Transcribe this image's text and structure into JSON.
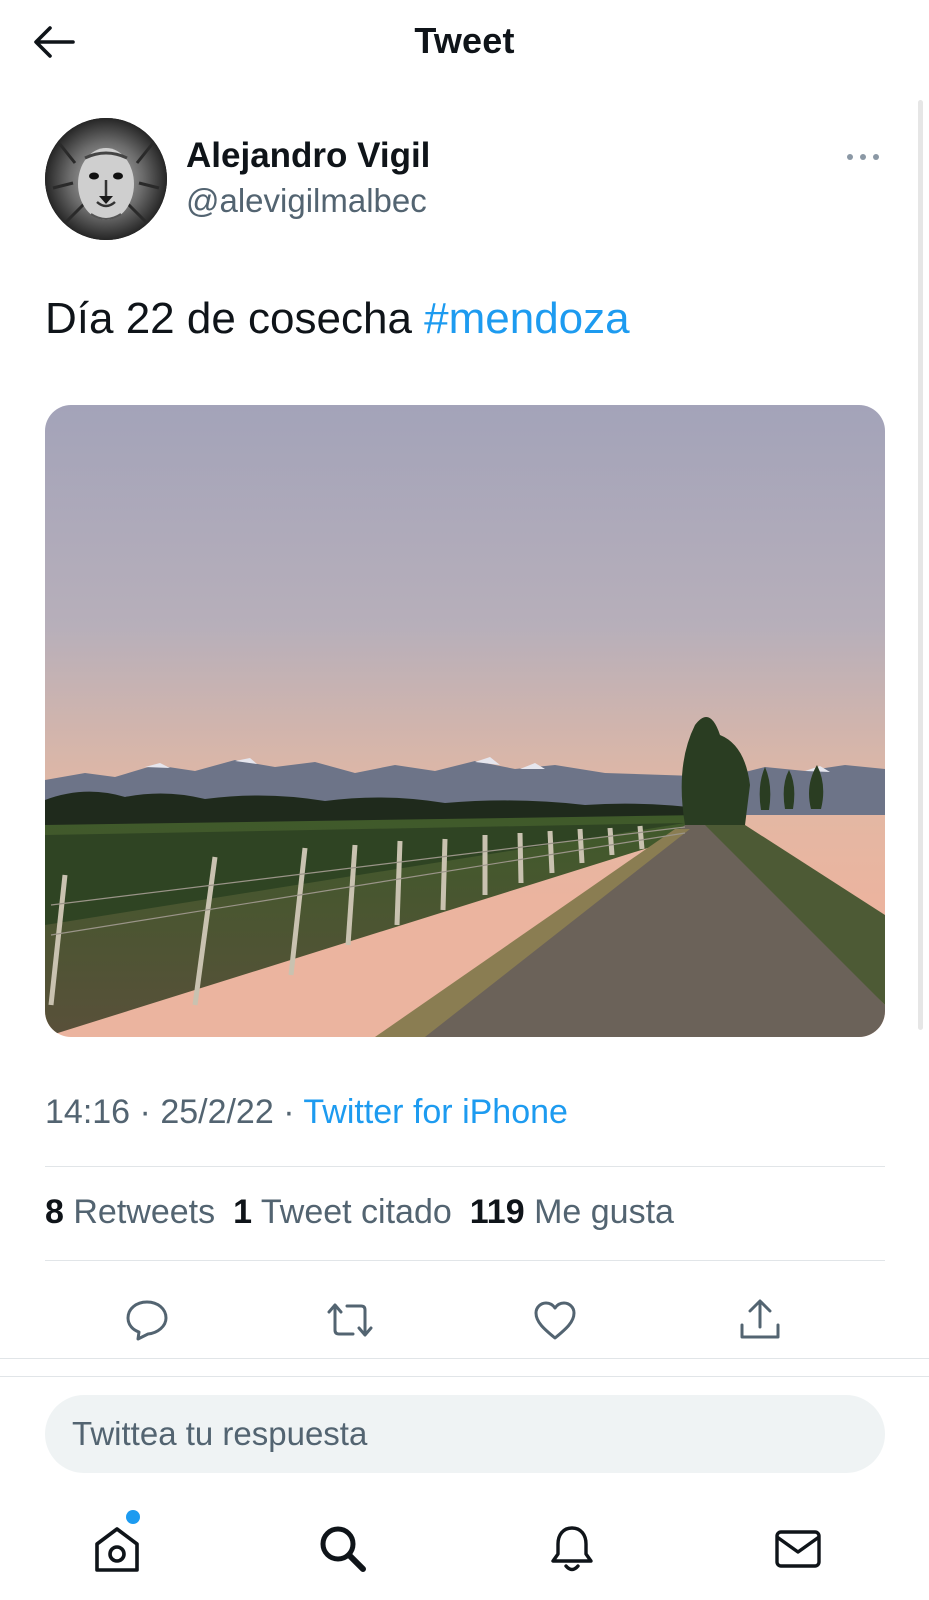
{
  "header": {
    "title": "Tweet",
    "back_icon": "arrow-left-icon"
  },
  "author": {
    "name": "Alejandro Vigil",
    "handle": "@alevigilmalbec",
    "avatar_icon": "lion-avatar"
  },
  "tweet": {
    "text": "Día 22 de cosecha ",
    "hashtag": "#mendoza",
    "time": "14:16",
    "separator": " · ",
    "date": "25/2/22",
    "source": "Twitter for iPhone"
  },
  "stats": {
    "retweets_count": "8",
    "retweets_label": "Retweets",
    "quotes_count": "1",
    "quotes_label": "Tweet citado",
    "likes_count": "119",
    "likes_label": "Me gusta"
  },
  "actions": [
    "reply-icon",
    "retweet-icon",
    "like-icon",
    "share-icon"
  ],
  "reply": {
    "placeholder": "Twittea tu respuesta"
  },
  "nav": {
    "items": [
      "home-icon",
      "search-icon",
      "notifications-icon",
      "messages-icon"
    ]
  },
  "colors": {
    "accent": "#1d9bf0",
    "text": "#0f1419",
    "secondary": "#536471"
  }
}
